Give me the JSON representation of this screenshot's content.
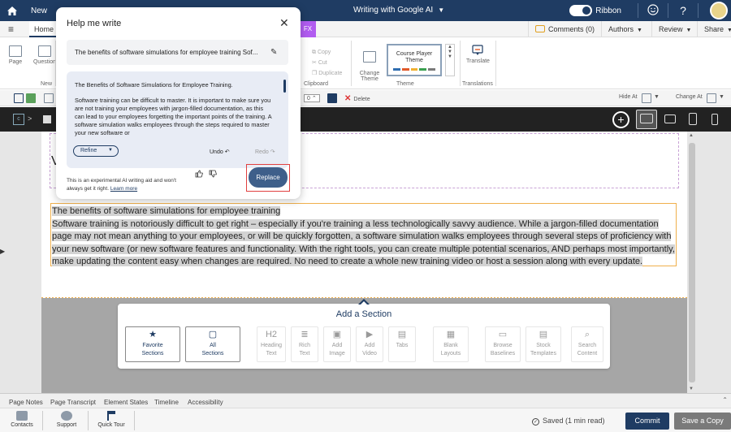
{
  "topbar": {
    "new_label": "New",
    "doc_title": "Writing with Google AI",
    "ribbon_label": "Ribbon",
    "help_glyph": "?"
  },
  "tabs": {
    "home": "Home",
    "fx": "FX",
    "comments": "Comments (0)",
    "authors": "Authors",
    "review": "Review",
    "share": "Share"
  },
  "ribbon": {
    "page": "Page",
    "question": "Question",
    "new_group": "New",
    "copy": "Copy",
    "cut": "Cut",
    "duplicate": "Duplicate",
    "clipboard_group": "Clipboard",
    "change_theme": "Change\nTheme",
    "theme_name": "Course Player\nTheme",
    "theme_group": "Theme",
    "translate": "Translate",
    "translations_group": "Translations",
    "theme_colors": [
      "#2f6db0",
      "#e05a2a",
      "#f0b030",
      "#3aa050",
      "#7a7a7a"
    ]
  },
  "toolbar2": {
    "spinner_value": "0",
    "delete": "Delete",
    "hide_at": "Hide At",
    "change_at": "Change At"
  },
  "stage": {
    "crumb_sep": ">",
    "crumb_icon": "c"
  },
  "content": {
    "heading": "The benefits of software simulations for employee training",
    "body": "Software training is notoriously difficult to get right – especially if you're training a less technologically savvy audience. While a jargon-filled documentation page may not mean anything to your employees, or will be quickly forgotten, a software simulation walks employees through several steps of proficiency with your new software (or new software features and functionality. With the right tools, you can create multiple potential scenarios, AND perhaps most importantly, make updating the content easy when changes are required. No need to create a whole new training video or host a session along with every update."
  },
  "add_section": {
    "title": "Add a Section",
    "buttons": [
      {
        "label": "Favorite\nSections",
        "icon": "★"
      },
      {
        "label": "All\nSections",
        "icon": "▢"
      },
      {
        "label": "Heading\nText",
        "icon": "H2"
      },
      {
        "label": "Rich\nText",
        "icon": "≣"
      },
      {
        "label": "Add\nImage",
        "icon": "▣"
      },
      {
        "label": "Add\nVideo",
        "icon": "▶"
      },
      {
        "label": "Tabs",
        "icon": "▤"
      },
      {
        "label": "Blank\nLayouts",
        "icon": "▦"
      },
      {
        "label": "Browse\nBaselines",
        "icon": "▭"
      },
      {
        "label": "Stock\nTemplates",
        "icon": "▤"
      },
      {
        "label": "Search\nContent",
        "icon": "⌕"
      }
    ]
  },
  "bottom_tabs": [
    "Page Notes",
    "Page Transcript",
    "Element States",
    "Timeline",
    "Accessibility"
  ],
  "footer": {
    "contacts": "Contacts",
    "support": "Support",
    "quick_tour": "Quick Tour",
    "saved": "Saved (1 min read)",
    "commit": "Commit",
    "save_copy": "Save a Copy"
  },
  "help_me_write": {
    "title": "Help me write",
    "prompt": "The benefits of software simulations for employee training Sof...",
    "result_title": "The Benefits of Software Simulations for Employee Training.",
    "result_body": "Software training can be difficult to master. It is important to make sure you are not training your employees with jargon-filled documentation, as this can lead to your employees forgetting the important points of the training. A software simulation walks employees through the steps required to master your new software or",
    "refine": "Refine",
    "undo": "Undo",
    "redo": "Redo",
    "disclaimer": "This is an experimental AI writing aid and won't always get it right.",
    "learn_more": "Learn more",
    "replace": "Replace"
  }
}
